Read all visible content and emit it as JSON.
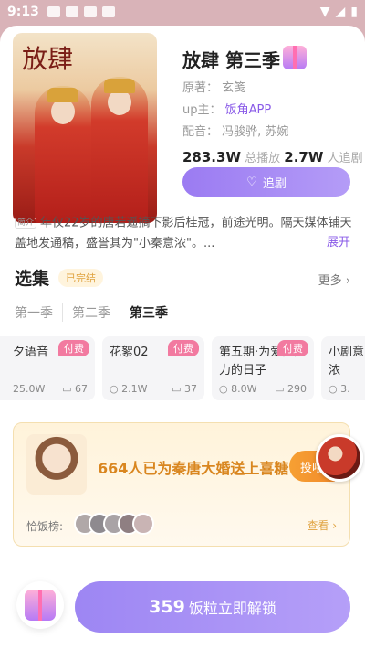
{
  "status_bar": {
    "time": "9:13"
  },
  "drama": {
    "title": "放肆 第三季",
    "cover_title": "放肆",
    "original_label": "原著：",
    "original_author": "玄笺",
    "up_label": "up主：",
    "up_name": "饭角APP",
    "voice_label": "配音：",
    "voice_actors": "冯骏骅, 苏婉",
    "play_count": "283.3W",
    "play_label": "总播放",
    "follow_count": "2.7W",
    "follow_label": "人追剧",
    "follow_button": "追剧",
    "intro_tag": "简介",
    "description": "年仅22岁的唐若遥摘下影后桂冠，前途光明。隔天媒体铺天盖地发通稿，盛誉其为\"小秦意浓\"。...",
    "expand": "展开"
  },
  "episodes_section": {
    "title": "选集",
    "status": "已完结",
    "more": "更多",
    "seasons": [
      {
        "label": "第一季",
        "active": false
      },
      {
        "label": "第二季",
        "active": false
      },
      {
        "label": "第三季",
        "active": true
      }
    ],
    "episodes": [
      {
        "title": "夕语音",
        "badge": "付费",
        "plays": "25.0W",
        "comments": "67"
      },
      {
        "title": "花絮02",
        "badge": "付费",
        "plays": "2.1W",
        "comments": "37"
      },
      {
        "title": "第五期·为爱而努力的日子",
        "badge": "付费",
        "plays": "8.0W",
        "comments": "290"
      },
      {
        "title": "小剧意浓",
        "badge": "",
        "plays": "3.",
        "comments": ""
      }
    ]
  },
  "candy": {
    "message": "664人已为秦唐大婚送上喜糖",
    "throw_button": "投喂",
    "fans_label": "恰饭榜:",
    "view_button": "查看"
  },
  "unlock": {
    "price": "359",
    "label": "饭粒立即解锁"
  }
}
